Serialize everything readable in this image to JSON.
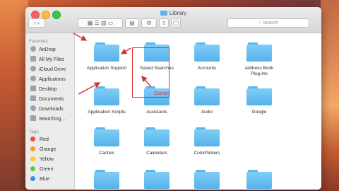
{
  "window": {
    "title": "Library"
  },
  "toolbar": {
    "search_placeholder": "Search",
    "view_modes": [
      "icon",
      "list",
      "column",
      "cover"
    ]
  },
  "sidebar": {
    "favorites_heading": "Favorites",
    "favorites": [
      {
        "label": "AirDrop",
        "icon": "airdrop-icon"
      },
      {
        "label": "All My Files",
        "icon": "all-files-icon"
      },
      {
        "label": "iCloud Drive",
        "icon": "cloud-icon"
      },
      {
        "label": "Applications",
        "icon": "applications-icon"
      },
      {
        "label": "Desktop",
        "icon": "desktop-icon"
      },
      {
        "label": "Documents",
        "icon": "documents-icon"
      },
      {
        "label": "Downloads",
        "icon": "downloads-icon"
      },
      {
        "label": "Searching...",
        "icon": "searching-icon"
      }
    ],
    "tags_heading": "Tags",
    "tags": [
      {
        "label": "Red",
        "color": "#f0473c"
      },
      {
        "label": "Orange",
        "color": "#f59b2b"
      },
      {
        "label": "Yellow",
        "color": "#f2cf2f"
      },
      {
        "label": "Green",
        "color": "#5dc94a"
      },
      {
        "label": "Blue",
        "color": "#3a8de8"
      }
    ]
  },
  "folders": [
    {
      "label": "Application Support"
    },
    {
      "label": "Saved Searches"
    },
    {
      "label": "Accounts"
    },
    {
      "label": "Address Book Plug-Ins"
    },
    {
      "label": "Application Scripts"
    },
    {
      "label": "Assistants"
    },
    {
      "label": "Audio"
    },
    {
      "label": "Google"
    },
    {
      "label": "Caches"
    },
    {
      "label": "Calendars"
    },
    {
      "label": "ColorPickers"
    },
    {
      "label": ""
    }
  ],
  "annotation": {
    "text": "Correct",
    "color": "#d63030"
  }
}
